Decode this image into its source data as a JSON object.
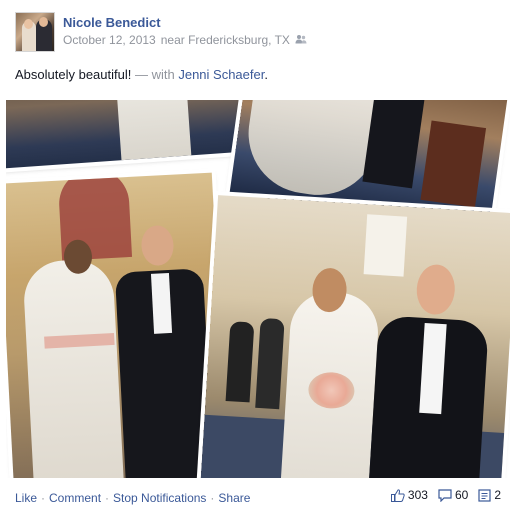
{
  "post": {
    "author": "Nicole Benedict",
    "date": "October 12, 2013",
    "location_text": "near Fredericksburg, TX",
    "audience_icon": "friends-icon",
    "caption": "Absolutely beautiful!",
    "with_text": "— with",
    "tagged": "Jenni Schaefer",
    "tag_suffix": "."
  },
  "actions": {
    "like": "Like",
    "comment": "Comment",
    "stop_notifications": "Stop Notifications",
    "share": "Share",
    "separator": "·"
  },
  "counts": {
    "likes": "303",
    "comments": "60",
    "shares": "2",
    "like_icon": "thumbs-up-icon",
    "comment_icon": "comment-bubble-icon",
    "share_icon": "share-icon"
  },
  "colors": {
    "link": "#3b5998",
    "meta": "#90949c",
    "text": "#141823"
  }
}
